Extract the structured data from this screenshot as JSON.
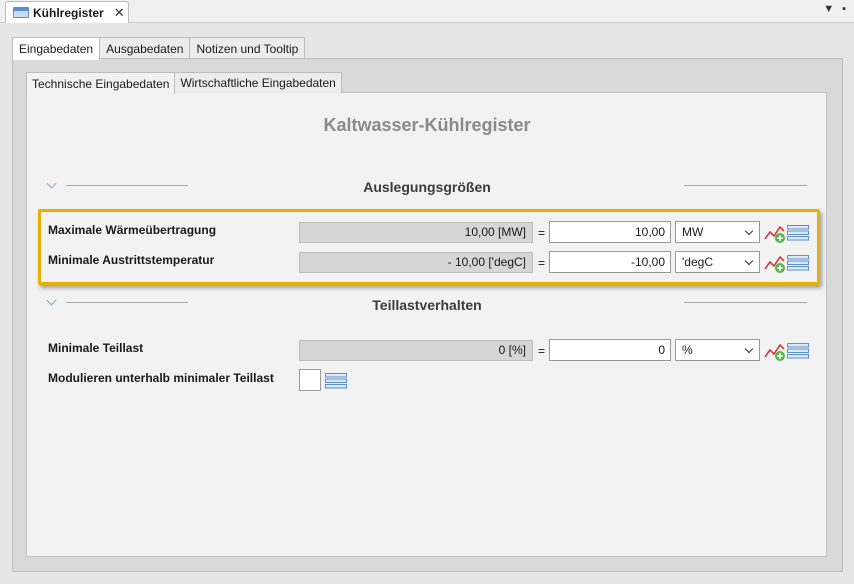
{
  "editor_tab": {
    "title": "Kühlregister",
    "close": "✕"
  },
  "bar_controls": {
    "menu": "▼",
    "maximize": "▪"
  },
  "outer_tabs": [
    "Eingabedaten",
    "Ausgabedaten",
    "Notizen und Tooltip"
  ],
  "inner_tabs": [
    "Technische Eingabedaten",
    "Wirtschaftliche Eingabedaten"
  ],
  "main_title": "Kaltwasser-Kühlregister",
  "sections": [
    {
      "title": "Auslegungsgrößen"
    },
    {
      "title": "Teillastverhalten"
    }
  ],
  "rows": [
    {
      "label": "Maximale Wärmeübertragung",
      "display": "10,00 [MW]",
      "eq": "=",
      "value": "10,00",
      "unit": "MW"
    },
    {
      "label": "Minimale Austrittstemperatur",
      "display": "- 10,00 ['degC]",
      "eq": "=",
      "value": "-10,00",
      "unit": "'degC"
    },
    {
      "label": "Minimale Teillast",
      "display": "0 [%]",
      "eq": "=",
      "value": "0",
      "unit": "%"
    }
  ],
  "checkbox_row": {
    "label": "Modulieren unterhalb minimaler Teillast",
    "checked": false
  },
  "colors": {
    "highlight": "#e8b100",
    "title_gray": "#8a8a8a",
    "icon_blue": "#5b8fcf"
  },
  "icons": [
    "chart-add-icon",
    "list-icon",
    "chevron-down-icon",
    "window-icon"
  ]
}
